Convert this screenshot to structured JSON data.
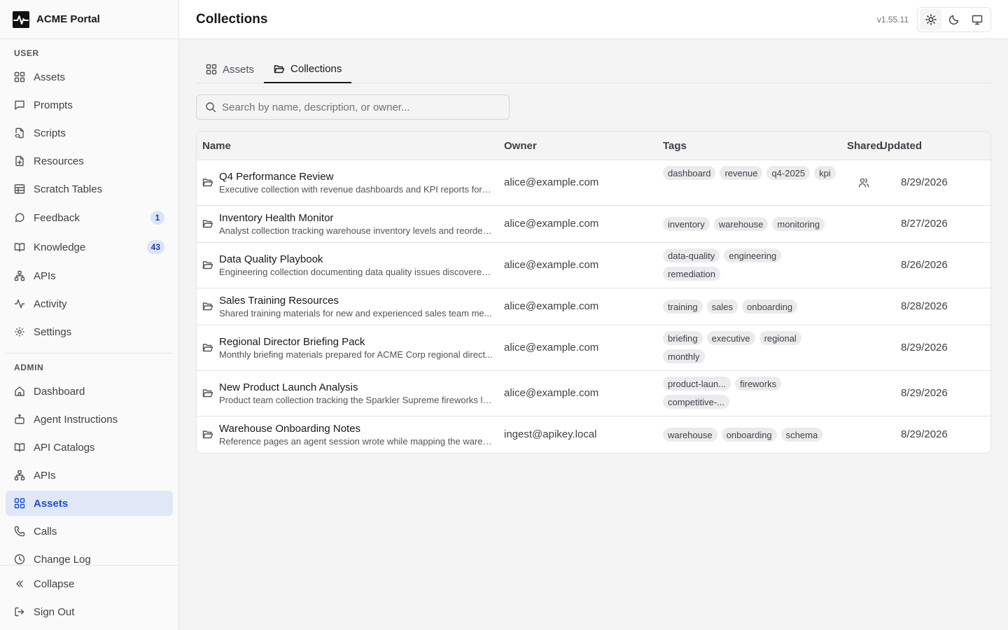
{
  "brand": {
    "name": "ACME Portal"
  },
  "sidebar": {
    "user_label": "USER",
    "user_items": [
      {
        "label": "Assets",
        "icon": "grid-icon"
      },
      {
        "label": "Prompts",
        "icon": "message-square-icon"
      },
      {
        "label": "Scripts",
        "icon": "file-code-icon"
      },
      {
        "label": "Resources",
        "icon": "file-plus-icon"
      },
      {
        "label": "Scratch Tables",
        "icon": "table-icon"
      },
      {
        "label": "Feedback",
        "icon": "message-circle-icon",
        "count": "1"
      },
      {
        "label": "Knowledge",
        "icon": "book-open-icon",
        "count": "43"
      },
      {
        "label": "APIs",
        "icon": "network-icon"
      },
      {
        "label": "Activity",
        "icon": "activity-icon"
      },
      {
        "label": "Settings",
        "icon": "gear-icon"
      }
    ],
    "admin_label": "ADMIN",
    "admin_items": [
      {
        "label": "Dashboard",
        "icon": "home-icon"
      },
      {
        "label": "Agent Instructions",
        "icon": "bot-icon"
      },
      {
        "label": "API Catalogs",
        "icon": "book-open-icon"
      },
      {
        "label": "APIs",
        "icon": "network-icon"
      },
      {
        "label": "Assets",
        "icon": "grid-icon",
        "active": true
      },
      {
        "label": "Calls",
        "icon": "phone-icon"
      },
      {
        "label": "Change Log",
        "icon": "clock-icon"
      }
    ],
    "footer": {
      "collapse": "Collapse",
      "sign_out": "Sign Out"
    }
  },
  "header": {
    "title": "Collections",
    "version": "v1.55.11",
    "theme_options": [
      "light",
      "dark",
      "system"
    ],
    "theme_selected": "light"
  },
  "tabs": [
    {
      "label": "Assets",
      "icon": "grid-icon",
      "active": false
    },
    {
      "label": "Collections",
      "icon": "folder-open-icon",
      "active": true
    }
  ],
  "search": {
    "placeholder": "Search by name, description, or owner...",
    "value": ""
  },
  "table": {
    "columns": {
      "name": "Name",
      "owner": "Owner",
      "tags": "Tags",
      "shared": "Shared",
      "updated": "Updated"
    },
    "rows": [
      {
        "name": "Q4 Performance Review",
        "description": "Executive collection with revenue dashboards and KPI reports for t...",
        "owner": "alice@example.com",
        "tags": [
          "dashboard",
          "revenue",
          "q4-2025",
          "kpi"
        ],
        "shared": true,
        "updated": "8/29/2026"
      },
      {
        "name": "Inventory Health Monitor",
        "description": "Analyst collection tracking warehouse inventory levels and reorder ...",
        "owner": "alice@example.com",
        "tags": [
          "inventory",
          "warehouse",
          "monitoring"
        ],
        "shared": false,
        "updated": "8/27/2026"
      },
      {
        "name": "Data Quality Playbook",
        "description": "Engineering collection documenting data quality issues discovered ...",
        "owner": "alice@example.com",
        "tags": [
          "data-quality",
          "engineering",
          "remediation"
        ],
        "shared": false,
        "updated": "8/26/2026"
      },
      {
        "name": "Sales Training Resources",
        "description": "Shared training materials for new and experienced sales team me...",
        "owner": "alice@example.com",
        "tags": [
          "training",
          "sales",
          "onboarding"
        ],
        "shared": false,
        "updated": "8/28/2026"
      },
      {
        "name": "Regional Director Briefing Pack",
        "description": "Monthly briefing materials prepared for ACME Corp regional direct...",
        "owner": "alice@example.com",
        "tags": [
          "briefing",
          "executive",
          "regional",
          "monthly"
        ],
        "shared": false,
        "updated": "8/29/2026"
      },
      {
        "name": "New Product Launch Analysis",
        "description": "Product team collection tracking the Sparkler Supreme fireworks la...",
        "owner": "alice@example.com",
        "tags": [
          "product-laun...",
          "fireworks",
          "competitive-..."
        ],
        "shared": false,
        "updated": "8/29/2026"
      },
      {
        "name": "Warehouse Onboarding Notes",
        "description": "Reference pages an agent session wrote while mapping the wareh...",
        "owner": "ingest@apikey.local",
        "tags": [
          "warehouse",
          "onboarding",
          "schema"
        ],
        "shared": false,
        "updated": "8/29/2026"
      }
    ]
  }
}
